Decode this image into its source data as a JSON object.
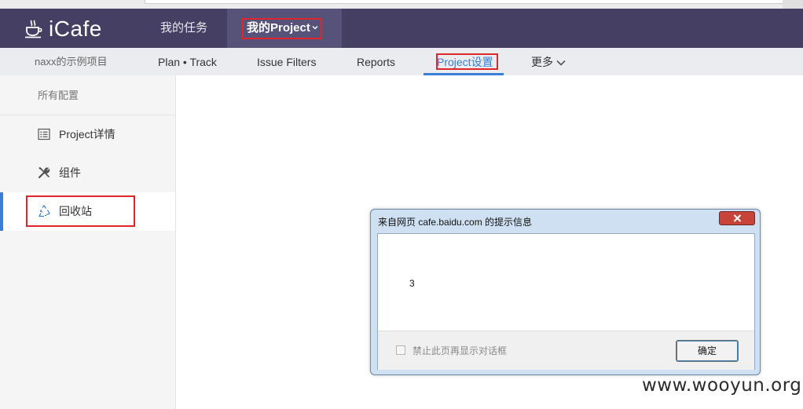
{
  "app": {
    "logo_text": "iCafe"
  },
  "topnav": {
    "items": [
      {
        "label": "我的任务"
      },
      {
        "label": "我的Project"
      }
    ]
  },
  "subnav": {
    "project_name": "naxx的示例项目",
    "items": [
      {
        "label": "Plan • Track"
      },
      {
        "label": "Issue Filters"
      },
      {
        "label": "Reports"
      },
      {
        "label": "Project设置",
        "active": true
      },
      {
        "label": "更多"
      }
    ]
  },
  "sidebar": {
    "heading": "所有配置",
    "items": [
      {
        "label": "Project详情",
        "icon": "list-icon"
      },
      {
        "label": "组件",
        "icon": "tools-icon"
      },
      {
        "label": "回收站",
        "icon": "recycle-icon",
        "active": true
      }
    ]
  },
  "dialog": {
    "title": "来自网页 cafe.baidu.com 的提示信息",
    "message": "3",
    "checkbox_label": "禁止此页再显示对话框",
    "checkbox_checked": false,
    "ok_label": "确定"
  },
  "watermark": "www.wooyun.org",
  "colors": {
    "topnav_bg": "#443f63",
    "topnav_active_bg": "#57527a",
    "accent_blue": "#3a7fd5",
    "highlight_red": "#e0262b"
  }
}
